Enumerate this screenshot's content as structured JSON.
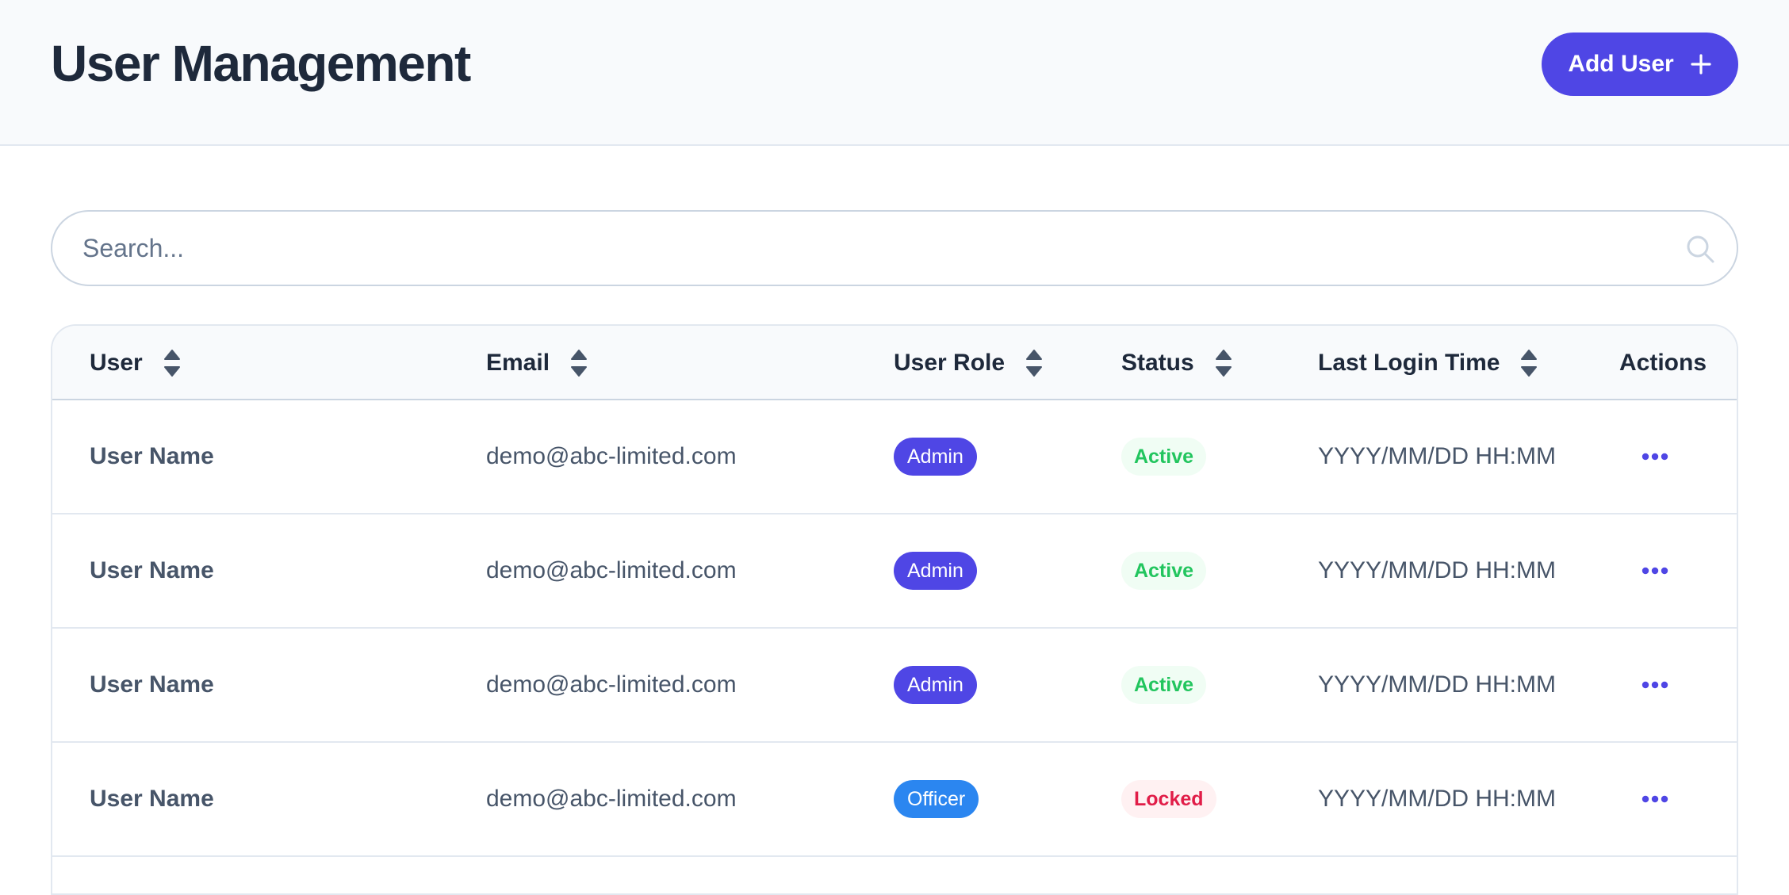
{
  "header": {
    "title": "User Management",
    "add_user_label": "Add User"
  },
  "search": {
    "placeholder": "Search...",
    "value": ""
  },
  "table": {
    "columns": [
      {
        "label": "User",
        "sortable": true
      },
      {
        "label": "Email",
        "sortable": true
      },
      {
        "label": "User Role",
        "sortable": true
      },
      {
        "label": "Status",
        "sortable": true
      },
      {
        "label": "Last Login Time",
        "sortable": true
      },
      {
        "label": "Actions",
        "sortable": false
      }
    ],
    "rows": [
      {
        "user": "User Name",
        "email": "demo@abc-limited.com",
        "role": "Admin",
        "status": "Active",
        "last_login": "YYYY/MM/DD HH:MM"
      },
      {
        "user": "User Name",
        "email": "demo@abc-limited.com",
        "role": "Admin",
        "status": "Active",
        "last_login": "YYYY/MM/DD HH:MM"
      },
      {
        "user": "User Name",
        "email": "demo@abc-limited.com",
        "role": "Admin",
        "status": "Active",
        "last_login": "YYYY/MM/DD HH:MM"
      },
      {
        "user": "User Name",
        "email": "demo@abc-limited.com",
        "role": "Officer",
        "status": "Locked",
        "last_login": "YYYY/MM/DD HH:MM"
      }
    ]
  },
  "colors": {
    "primary": "#4f46e5",
    "role_admin": "#4f46e5",
    "role_officer": "#2b86f0",
    "status_active_text": "#22c55e",
    "status_active_bg": "#f0fdf4",
    "status_locked_text": "#e11d48",
    "status_locked_bg": "#fff1f2",
    "actions_icon": "#4f46e5"
  },
  "icons": {
    "add": "plus-icon",
    "search": "search-icon",
    "sort": "sort-icon",
    "actions": "more-dots-icon"
  }
}
